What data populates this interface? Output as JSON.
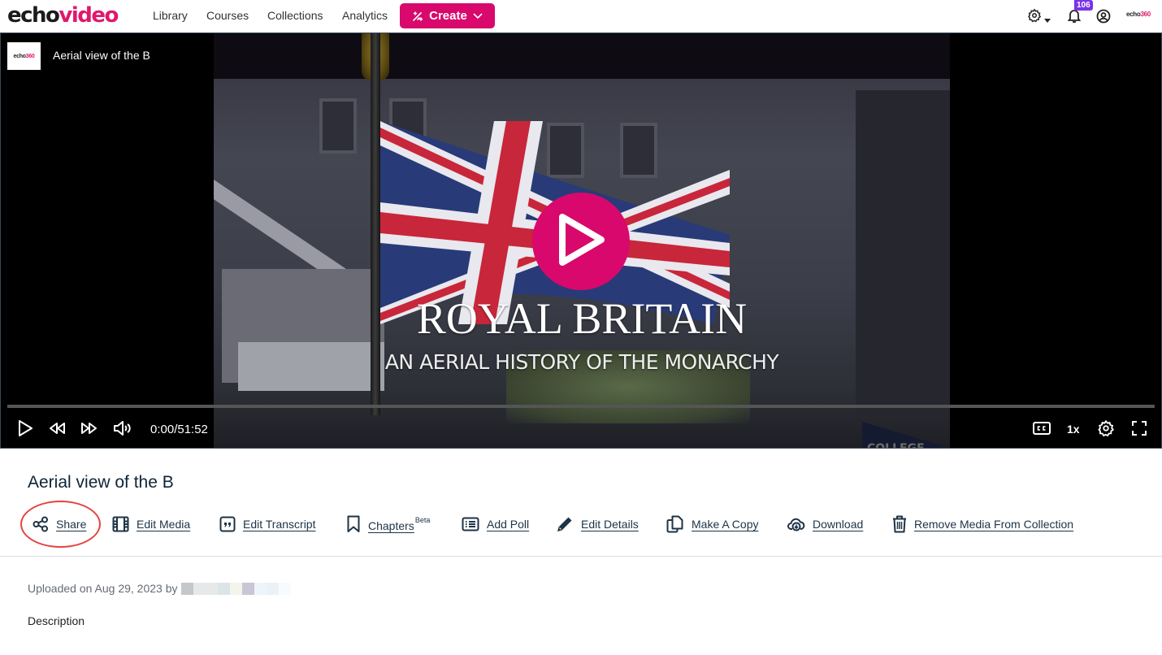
{
  "nav": {
    "logo": {
      "part1": "echo",
      "part2": "video"
    },
    "links": [
      "Library",
      "Courses",
      "Collections",
      "Analytics"
    ],
    "create_label": "Create",
    "notifications_count": "106",
    "brand": {
      "part1": "echo",
      "part2": "360"
    }
  },
  "player": {
    "logo": {
      "part1": "echo",
      "part2": "360"
    },
    "title": "Aerial view of the B",
    "frame_text": {
      "headline": "ROYAL BRITAIN",
      "subheadline": "AN AERIAL HISTORY OF THE MONARCHY",
      "watermark": "COLLEGE"
    },
    "time": "0:00/51:52",
    "progress_percent": 0,
    "speed": "1x"
  },
  "media": {
    "title": "Aerial view of the B",
    "actions": [
      {
        "label": "Share",
        "icon": "share-icon"
      },
      {
        "label": "Edit Media",
        "icon": "film-icon"
      },
      {
        "label": "Edit Transcript",
        "icon": "quote-icon"
      },
      {
        "label": "Chapters",
        "sup": "Beta",
        "icon": "bookmark-icon"
      },
      {
        "label": "Add Poll",
        "icon": "list-icon"
      },
      {
        "label": "Edit Details",
        "icon": "pencil-icon"
      },
      {
        "label": "Make A Copy",
        "icon": "copy-icon"
      },
      {
        "label": "Download",
        "icon": "cloud-download-icon"
      },
      {
        "label": "Remove Media From Collection",
        "icon": "trash-icon"
      }
    ],
    "uploaded_prefix": "Uploaded on Aug 29, 2023 by",
    "redacted_colors": [
      "#c5c8cb",
      "#e6e9ea",
      "#e7e8e8",
      "#dbe5e8",
      "#f3f4ea",
      "#cac6d5",
      "#eef4fb",
      "#ebf2f6",
      "#f8fbfe"
    ],
    "description_label": "Description"
  },
  "colors": {
    "accent": "#d8086c",
    "annotation_ring": "#e5433e",
    "badge": "#7a32e8"
  }
}
